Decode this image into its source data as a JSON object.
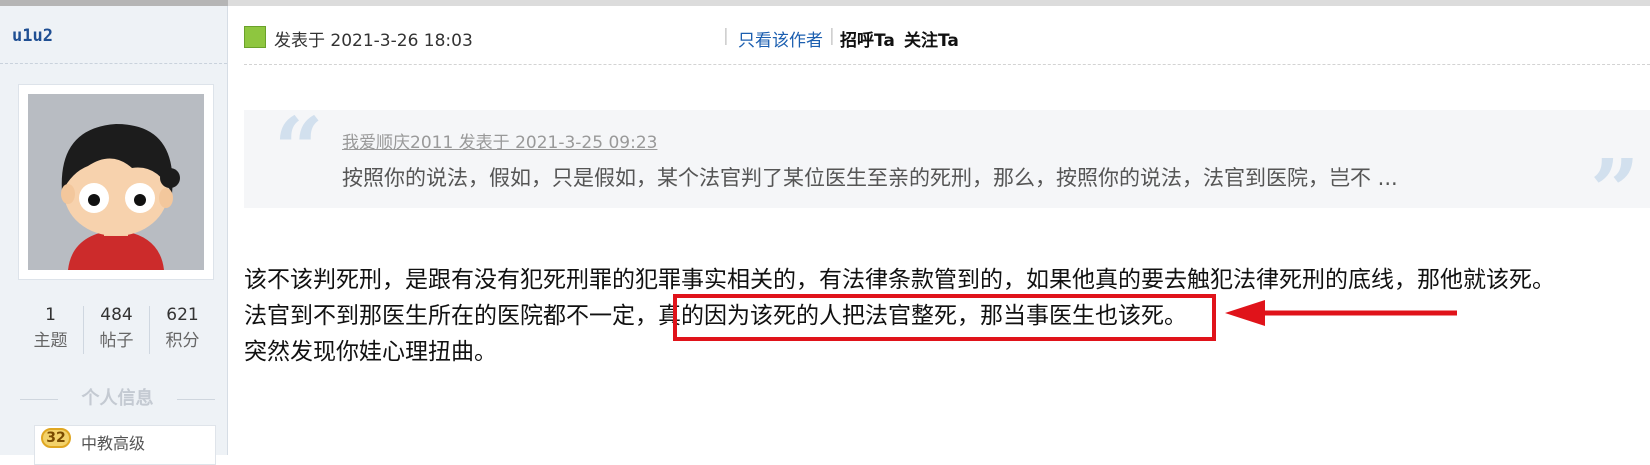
{
  "sidebar": {
    "username": "u1u2",
    "stats": [
      {
        "value": "1",
        "label": "主题"
      },
      {
        "value": "484",
        "label": "帖子"
      },
      {
        "value": "621",
        "label": "积分"
      }
    ],
    "personal_info_label": "个人信息",
    "level": {
      "badge": "32",
      "title": "中教高级"
    }
  },
  "post": {
    "posted_at": "发表于 2021-3-26 18:03",
    "only_author_label": "只看该作者",
    "greet_label": "招呼Ta",
    "follow_label": "关注Ta",
    "quote": {
      "meta": "我爱顺庆2011 发表于 2021-3-25 09:23",
      "text": "按照你的说法，假如，只是假如，某个法官判了某位医生至亲的死刑，那么，按照你的说法，法官到医院，岂不 ..."
    },
    "body_lines": [
      "该不该判死刑，是跟有没有犯死刑罪的犯罪事实相关的，有法律条款管到的，如果他真的要去触犯法律死刑的底线，那他就该死。",
      "法官到不到那医生所在的医院都不一定，真的因为该死的人把法官整死，那当事医生也该死。",
      "突然发现你娃心理扭曲。"
    ]
  },
  "colors": {
    "link": "#1c5fb0",
    "username": "#1f4f93",
    "annotation_red": "#e0131a",
    "sidebar_bg": "#eef2f6"
  }
}
